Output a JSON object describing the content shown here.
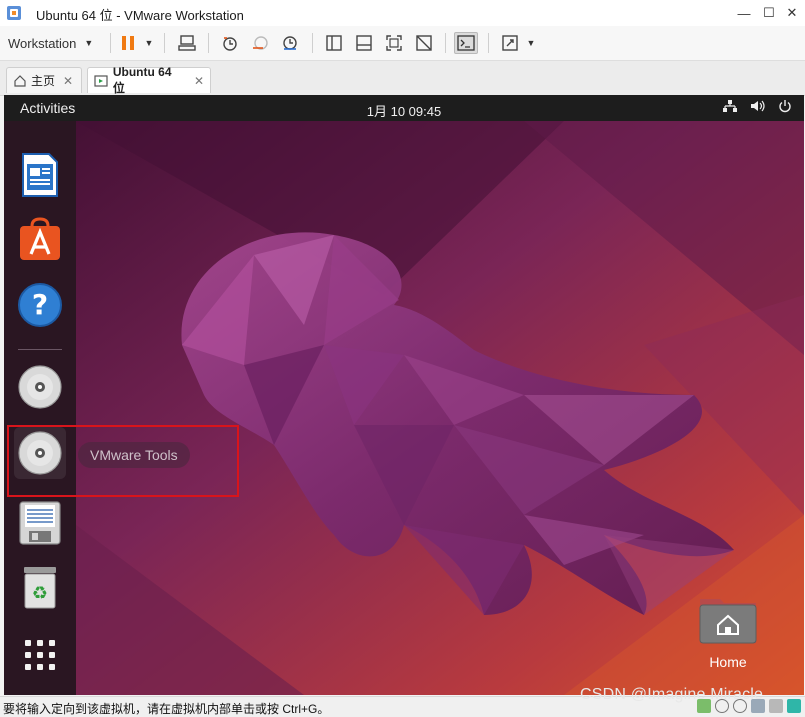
{
  "window": {
    "title": "Ubuntu 64 位 - VMware Workstation",
    "controls": {
      "minimize": "—",
      "maximize": "☐",
      "close": "✕"
    }
  },
  "toolbar": {
    "menu_label": "Workstation",
    "icons": [
      "pause-icon",
      "send-keys-icon",
      "snapshot-take-icon",
      "snapshot-revert-icon",
      "snapshot-manager-icon",
      "view-sidebar-icon",
      "view-thumbnail-icon",
      "fullscreen-icon",
      "unity-icon",
      "console-icon",
      "stretch-icon"
    ]
  },
  "tabs": [
    {
      "label": "主页",
      "icon": "home-icon"
    },
    {
      "label": "Ubuntu 64 位",
      "icon": "vm-icon",
      "active": true
    }
  ],
  "ubuntu": {
    "activities": "Activities",
    "clock": "1月 10  09:45",
    "tray_icons": [
      "network-icon",
      "volume-icon",
      "power-icon"
    ],
    "dock_items": [
      "libreoffice-writer-icon",
      "app-center-icon",
      "help-icon",
      "cdrom-icon",
      "vmware-tools-cdrom-icon",
      "floppy-icon",
      "trash-icon",
      "app-grid-icon"
    ],
    "tooltip": "VMware Tools",
    "desktop_home_label": "Home"
  },
  "statusbar": {
    "message": "要将输入定向到该虚拟机，请在虚拟机内部单击或按 Ctrl+G。",
    "watermark": "CSDN @Imagine Miracle"
  },
  "colors": {
    "highlight_box": "#d9141b",
    "accent_orange": "#e95420",
    "wallpaper_dark": "#3a0f2f",
    "wallpaper_warm": "#c9422b"
  }
}
